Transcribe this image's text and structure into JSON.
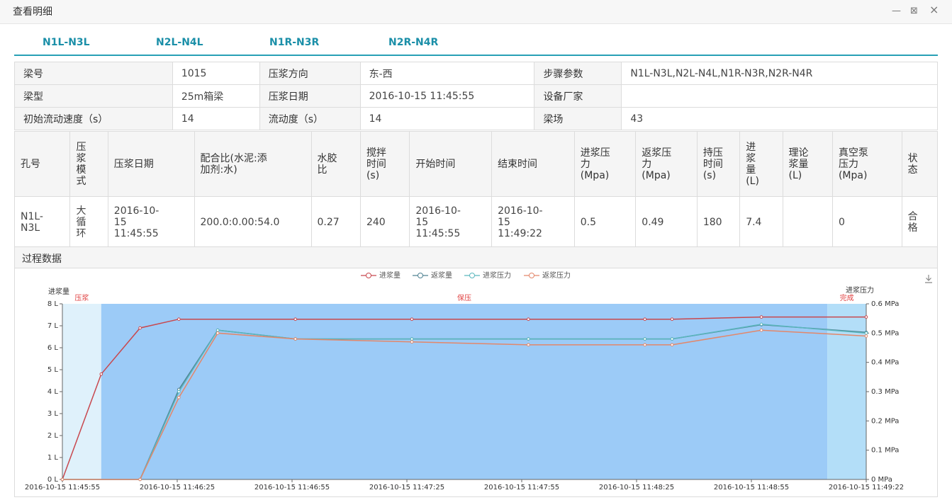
{
  "window": {
    "title": "查看明细",
    "minimize_glyph": "—",
    "maximize_glyph": "⊠",
    "close_glyph": "×"
  },
  "tabs": [
    {
      "label": "N1L-N3L"
    },
    {
      "label": "N2L-N4L"
    },
    {
      "label": "N1R-N3R"
    },
    {
      "label": "N2R-N4R"
    }
  ],
  "info": {
    "beam_no_label": "梁号",
    "beam_no": "1015",
    "grout_dir_label": "压浆方向",
    "grout_dir": "东-西",
    "step_params_label": "步骤参数",
    "step_params": "N1L-N3L,N2L-N4L,N1R-N3R,N2R-N4R",
    "beam_type_label": "梁型",
    "beam_type": "25m箱梁",
    "grout_date_label": "压浆日期",
    "grout_date": "2016-10-15 11:45:55",
    "maker_label": "设备厂家",
    "maker": "",
    "init_speed_label": "初始流动速度（s）",
    "init_speed": "14",
    "fluidity_label": "流动度（s）",
    "fluidity": "14",
    "yard_label": "梁场",
    "yard": "43"
  },
  "detail": {
    "headers": {
      "hole": "孔号",
      "mode": "压\n浆\n模\n式",
      "date": "压浆日期",
      "ratio": "配合比(水泥:添\n加剂:水)",
      "wcr": "水胶\n比",
      "stir": "搅拌\n时间\n(s)",
      "start": "开始时间",
      "end": "结束时间",
      "in_p": "进浆压\n力\n(Mpa)",
      "out_p": "返浆压\n力\n(Mpa)",
      "hold": "持压\n时间\n(s)",
      "vol": "进\n浆\n量\n(L)",
      "theo": "理论\n浆量\n(L)",
      "vac": "真空泵\n压力\n(Mpa)",
      "status": "状\n态"
    },
    "row": {
      "hole": "N1L-\nN3L",
      "mode": "大\n循\n环",
      "date": "2016-10-\n15\n11:45:55",
      "ratio": "200.0:0.00:54.0",
      "wcr": "0.27",
      "stir": "240",
      "start": "2016-10-\n15\n11:45:55",
      "end": "2016-10-\n15\n11:49:22",
      "in_p": "0.5",
      "out_p": "0.49",
      "hold": "180",
      "vol": "7.4",
      "theo": "",
      "vac": "0",
      "status": "合\n格"
    }
  },
  "process": {
    "title": "过程数据",
    "download_icon": "download-icon"
  },
  "chart_data": {
    "type": "line",
    "left_axis_title": "进浆量",
    "right_axis_title": "进浆压力",
    "left_ticks": [
      "0 L",
      "1 L",
      "2 L",
      "3 L",
      "4 L",
      "5 L",
      "6 L",
      "7 L",
      "8 L"
    ],
    "right_ticks": [
      "0 MPa",
      "0.1 MPa",
      "0.2 MPa",
      "0.3 MPa",
      "0.4 MPa",
      "0.5 MPa",
      "0.6 MPa"
    ],
    "x_labels": [
      "2016-10-15 11:45:55",
      "2016-10-15 11:46:25",
      "2016-10-15 11:46:55",
      "2016-10-15 11:47:25",
      "2016-10-15 11:47:55",
      "2016-10-15 11:48:25",
      "2016-10-15 11:48:55",
      "2016-10-15 11:49:22"
    ],
    "x_seconds_range": [
      0,
      207
    ],
    "ylim_left": [
      0,
      8
    ],
    "ylim_right": [
      0,
      0.6
    ],
    "phases": [
      {
        "label": "压浆",
        "start_s": 0,
        "end_s": 10,
        "color": "#dff1fb"
      },
      {
        "label": "保压",
        "start_s": 10,
        "end_s": 197,
        "color": "#9ccbf7"
      },
      {
        "label": "完成",
        "start_s": 197,
        "end_s": 207,
        "color": "#b3def8"
      }
    ],
    "series": [
      {
        "name": "进浆量",
        "axis": "left",
        "color": "#c8484e",
        "points": [
          [
            0,
            0
          ],
          [
            10,
            4.8
          ],
          [
            20,
            6.9
          ],
          [
            30,
            7.3
          ],
          [
            60,
            7.3
          ],
          [
            90,
            7.3
          ],
          [
            120,
            7.3
          ],
          [
            150,
            7.3
          ],
          [
            157,
            7.3
          ],
          [
            180,
            7.4
          ],
          [
            207,
            7.4
          ]
        ]
      },
      {
        "name": "返浆量",
        "axis": "left",
        "color": "#4f8292",
        "points": [
          [
            0,
            0
          ],
          [
            20,
            0
          ],
          [
            30,
            4.1
          ],
          [
            40,
            6.8
          ],
          [
            60,
            6.4
          ],
          [
            90,
            6.4
          ],
          [
            120,
            6.4
          ],
          [
            150,
            6.4
          ],
          [
            157,
            6.4
          ],
          [
            180,
            7.05
          ],
          [
            207,
            6.7
          ]
        ]
      },
      {
        "name": "进浆压力",
        "axis": "right",
        "color": "#5ab6bd",
        "points": [
          [
            0,
            0
          ],
          [
            20,
            0
          ],
          [
            30,
            0.3
          ],
          [
            40,
            0.51
          ],
          [
            60,
            0.48
          ],
          [
            90,
            0.48
          ],
          [
            120,
            0.48
          ],
          [
            150,
            0.48
          ],
          [
            157,
            0.48
          ],
          [
            180,
            0.53
          ],
          [
            207,
            0.5
          ]
        ]
      },
      {
        "name": "返浆压力",
        "axis": "right",
        "color": "#e3876a",
        "points": [
          [
            0,
            0
          ],
          [
            20,
            0
          ],
          [
            30,
            0.28
          ],
          [
            40,
            0.5
          ],
          [
            60,
            0.48
          ],
          [
            90,
            0.47
          ],
          [
            120,
            0.46
          ],
          [
            150,
            0.46
          ],
          [
            157,
            0.46
          ],
          [
            180,
            0.51
          ],
          [
            207,
            0.49
          ]
        ]
      }
    ],
    "legend_position": "top-center",
    "grid": false
  }
}
